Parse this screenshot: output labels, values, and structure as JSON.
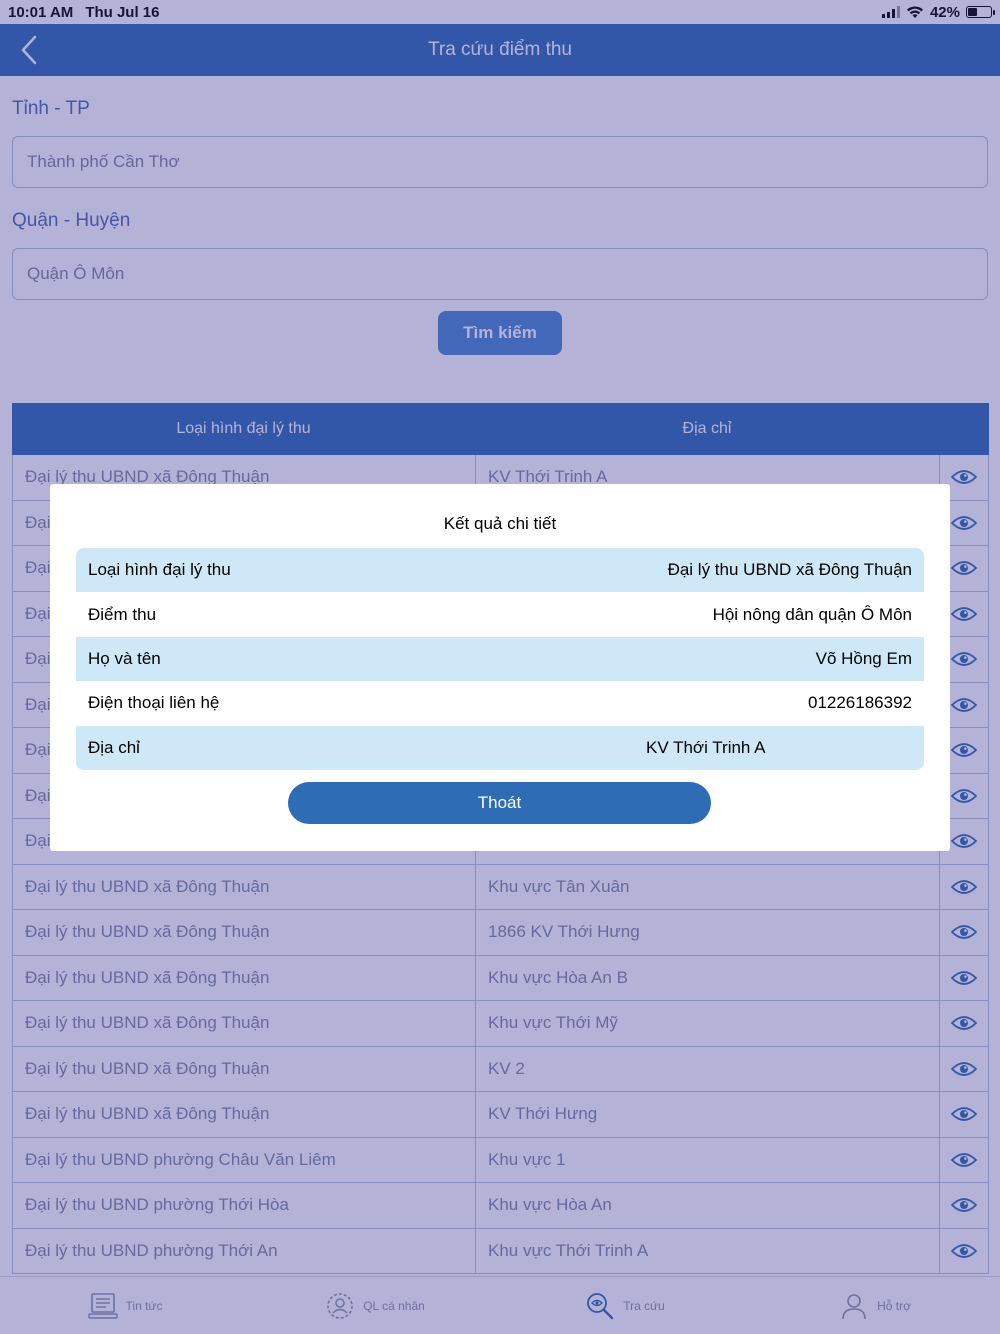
{
  "status_bar": {
    "time": "10:01 AM",
    "date": "Thu Jul 16",
    "battery": "42%",
    "battery_level": 0.42
  },
  "nav": {
    "title": "Tra cứu điểm thu",
    "back_icon": "chevron-left-icon"
  },
  "form": {
    "province_label": "Tỉnh - TP",
    "province_value": "Thành phố Cần Thơ",
    "district_label": "Quận - Huyện",
    "district_value": "Quận Ô Môn",
    "search_label": "Tìm kiếm"
  },
  "table": {
    "headers": [
      "Loại hình đại lý thu",
      "Địa chỉ"
    ],
    "rows": [
      {
        "type": "Đại lý thu UBND xã Đông Thuận",
        "address": "KV Thới Trinh A"
      },
      {
        "type": "Đại",
        "address": ""
      },
      {
        "type": "Đại",
        "address": ""
      },
      {
        "type": "Đại",
        "address": ""
      },
      {
        "type": "Đại",
        "address": ""
      },
      {
        "type": "Đại",
        "address": ""
      },
      {
        "type": "Đại",
        "address": ""
      },
      {
        "type": "Đại",
        "address": ""
      },
      {
        "type": "Đại",
        "address": ""
      },
      {
        "type": "Đại lý thu UBND xã Đông Thuận",
        "address": "Khu vực Tân Xuân"
      },
      {
        "type": "Đại lý thu UBND xã Đông Thuận",
        "address": "1866 KV Thới Hưng"
      },
      {
        "type": "Đại lý thu UBND xã Đông Thuận",
        "address": "Khu vực Hòa An B"
      },
      {
        "type": "Đại lý thu UBND xã Đông Thuận",
        "address": "Khu vực Thới Mỹ"
      },
      {
        "type": "Đại lý thu UBND xã Đông Thuận",
        "address": "KV 2"
      },
      {
        "type": "Đại lý thu UBND xã Đông Thuận",
        "address": "KV Thới Hưng"
      },
      {
        "type": "Đại lý thu UBND phường Châu Văn Liêm",
        "address": "Khu vực 1"
      },
      {
        "type": "Đại lý thu UBND phường Thới Hòa",
        "address": "Khu vực Hòa An"
      },
      {
        "type": "Đại lý thu UBND phường Thới An",
        "address": "Khu vực Thới Trinh A"
      }
    ],
    "row_icon": "eye-icon"
  },
  "tabs": [
    {
      "label": "Tin tức",
      "icon": "news-icon"
    },
    {
      "label": "QL cá nhân",
      "icon": "personal-icon"
    },
    {
      "label": "Tra cứu",
      "icon": "search-icon"
    },
    {
      "label": "Hỗ trợ",
      "icon": "support-icon"
    }
  ],
  "modal": {
    "title": "Kết quả chi tiết",
    "rows": [
      {
        "key": "Loại hình đại lý thu",
        "value": "Đại lý thu UBND xã Đông Thuận"
      },
      {
        "key": "Điểm thu",
        "value": "Hội nông dân quận Ô Môn"
      },
      {
        "key": "Họ và tên",
        "value": "Võ Hồng Em"
      },
      {
        "key": "Điện thoại liên hệ",
        "value": "01226186392"
      },
      {
        "key": "Địa chỉ",
        "value": "KV Thới Trinh A"
      }
    ],
    "exit_label": "Thoát"
  },
  "colors": {
    "primary": "#2e6db5",
    "row_highlight": "#cfe8f8",
    "overlay": "rgba(58,52,150,0.38)"
  }
}
